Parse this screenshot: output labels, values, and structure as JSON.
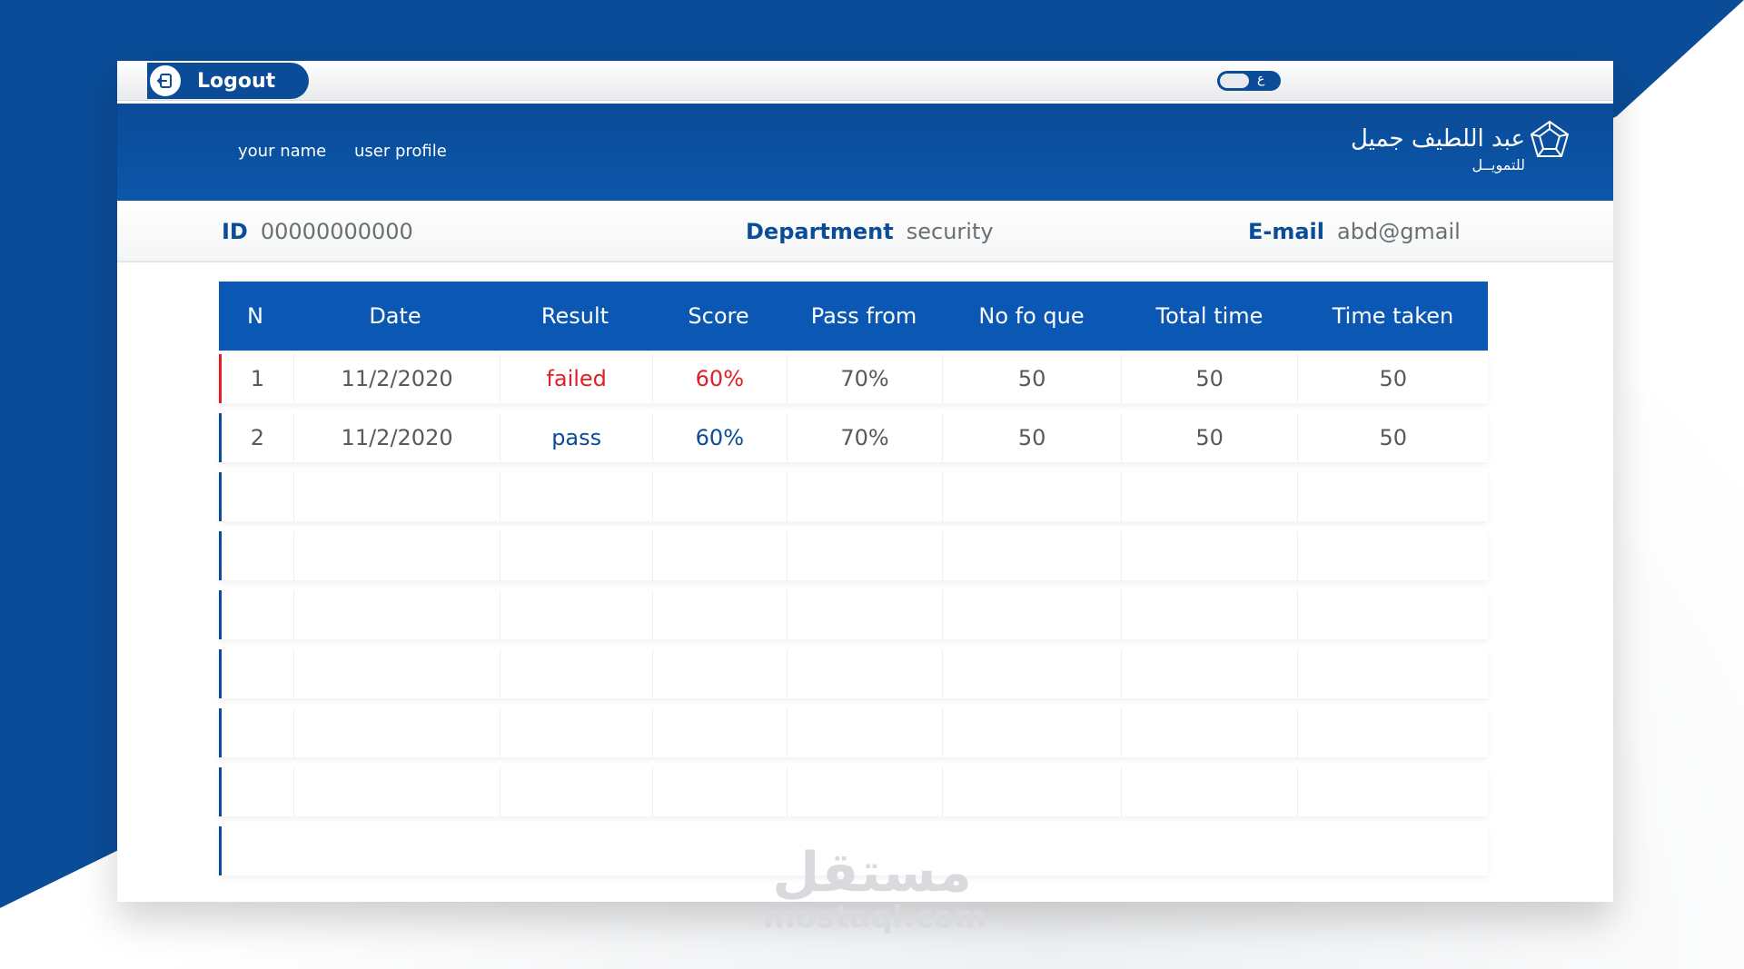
{
  "topbar": {
    "logout_label": "Logout",
    "lang_letter": "ع"
  },
  "header": {
    "your_name": "your name",
    "user_profile": "user profile",
    "logo_line1": "عبد اللطيف جميل",
    "logo_line2": "للتمويــل"
  },
  "info": {
    "id_label": "ID",
    "id_value": "00000000000",
    "department_label": "Department",
    "department_value": "security",
    "email_label": "E-mail",
    "email_value": "abd@gmail"
  },
  "table": {
    "columns": [
      "N",
      "Date",
      "Result",
      "Score",
      "Pass from",
      "No fo que",
      "Total time",
      "Time taken"
    ],
    "rows": [
      {
        "n": "1",
        "date": "11/2/2020",
        "result": "failed",
        "score": "60%",
        "pass_from": "70%",
        "no_fo_que": "50",
        "total_time": "50",
        "time_taken": "50"
      },
      {
        "n": "2",
        "date": "11/2/2020",
        "result": "pass",
        "score": "60%",
        "pass_from": "70%",
        "no_fo_que": "50",
        "total_time": "50",
        "time_taken": "50"
      }
    ]
  },
  "colors": {
    "brand_blue": "#0a4c98",
    "header_blue": "#0b58b4",
    "failed_red": "#e11f26"
  },
  "watermark": {
    "arabic": "مستقل",
    "latin": "mostaql.com"
  }
}
